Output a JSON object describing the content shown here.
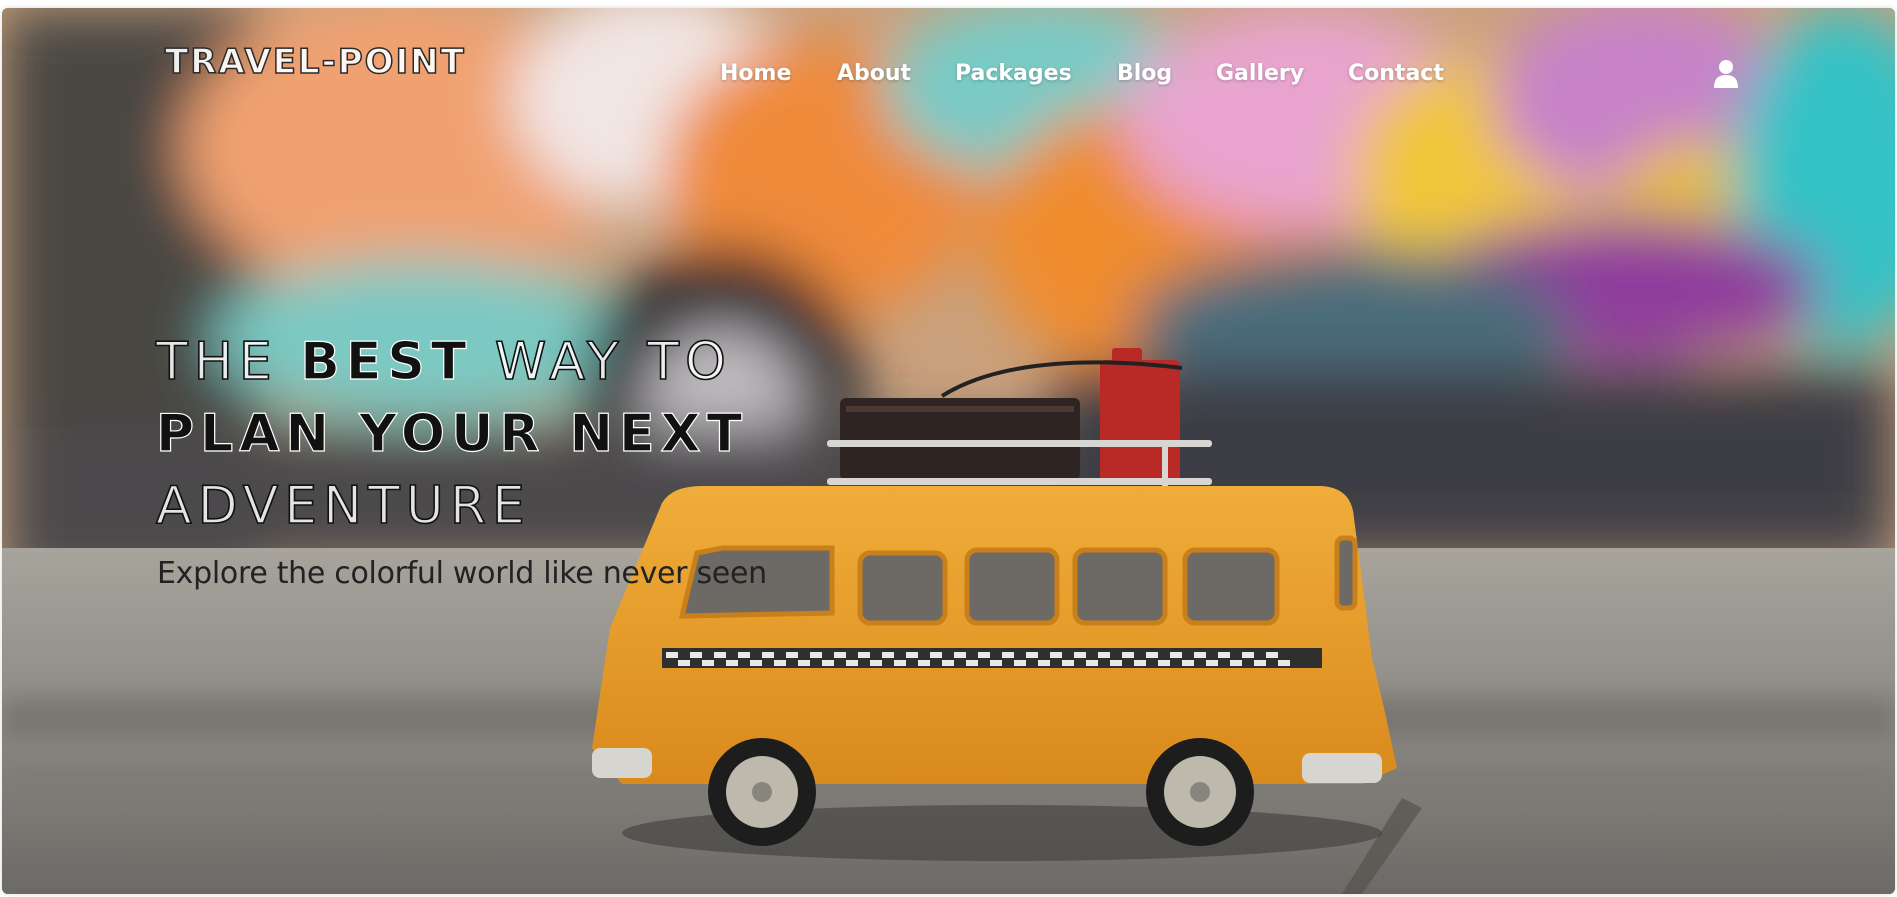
{
  "brand": {
    "logo_text": "TRAVEL-POINT"
  },
  "nav": {
    "items": [
      {
        "label": "Home"
      },
      {
        "label": "About"
      },
      {
        "label": "Packages"
      },
      {
        "label": "Blog"
      },
      {
        "label": "Gallery"
      },
      {
        "label": "Contact"
      }
    ],
    "user_icon": "user-icon"
  },
  "hero": {
    "headline": {
      "line1_a": "THE ",
      "line1_b": "BEST",
      "line1_c": " WAY TO",
      "line2": "PLAN YOUR NEXT",
      "line3": "ADVENTURE"
    },
    "subtitle": "Explore the colorful world like never seen",
    "background_image": "toy yellow van with luggage on roof in front of blurred colorful graffiti wall"
  },
  "colors": {
    "nav_text": "#ffffff",
    "headline_dark": "#111111",
    "van_yellow": "#e8a12e"
  }
}
